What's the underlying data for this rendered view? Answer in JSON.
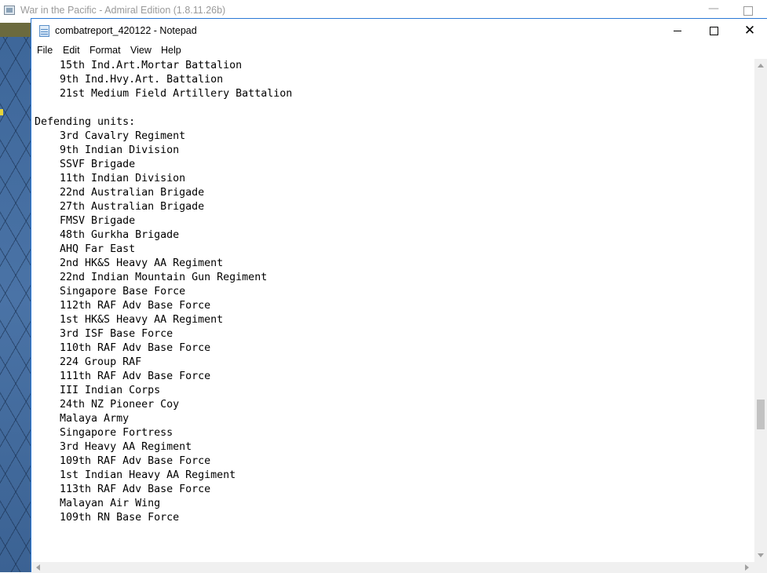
{
  "background_window": {
    "title": "War in the Pacific - Admiral Edition (1.8.11.26b)"
  },
  "notepad": {
    "title": "combatreport_420122 - Notepad",
    "menu": [
      "File",
      "Edit",
      "Format",
      "View",
      "Help"
    ],
    "lines": [
      "    15th Ind.Art.Mortar Battalion",
      "    9th Ind.Hvy.Art. Battalion",
      "    21st Medium Field Artillery Battalion",
      "",
      "Defending units:",
      "    3rd Cavalry Regiment",
      "    9th Indian Division",
      "    SSVF Brigade",
      "    11th Indian Division",
      "    22nd Australian Brigade",
      "    27th Australian Brigade",
      "    FMSV Brigade",
      "    48th Gurkha Brigade",
      "    AHQ Far East",
      "    2nd HK&S Heavy AA Regiment",
      "    22nd Indian Mountain Gun Regiment",
      "    Singapore Base Force",
      "    112th RAF Adv Base Force",
      "    1st HK&S Heavy AA Regiment",
      "    3rd ISF Base Force",
      "    110th RAF Adv Base Force",
      "    224 Group RAF",
      "    111th RAF Adv Base Force",
      "    III Indian Corps",
      "    24th NZ Pioneer Coy",
      "    Malaya Army",
      "    Singapore Fortress",
      "    3rd Heavy AA Regiment",
      "    109th RAF Adv Base Force",
      "    1st Indian Heavy AA Regiment",
      "    113th RAF Adv Base Force",
      "    Malayan Air Wing",
      "    109th RN Base Force"
    ]
  },
  "icons": {
    "app": "game-app-icon",
    "notepad": "notepad-icon",
    "minimize": "minimize-icon",
    "maximize": "maximize-icon",
    "close": "close-icon"
  },
  "colors": {
    "window_border": "#2b79d6",
    "map_water": "#3f6a9e"
  }
}
